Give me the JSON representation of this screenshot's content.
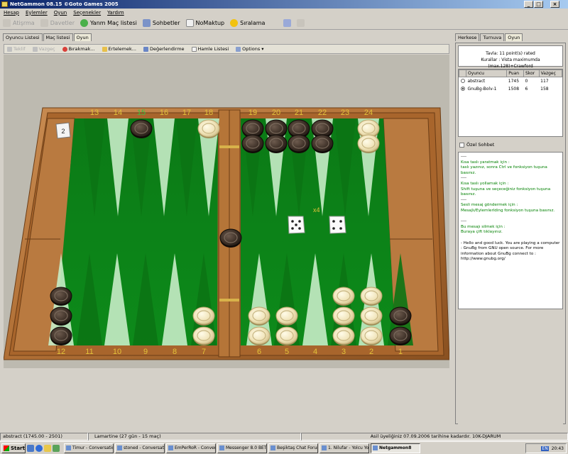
{
  "window": {
    "title": "NetGammon 08.15 ©Goto Games 2005",
    "controls": [
      "_",
      "□",
      "×"
    ]
  },
  "menu": [
    "Hesap",
    "Eylemler",
    "Oyun",
    "Seçenekler",
    "Yardım"
  ],
  "toolbar": {
    "items": [
      {
        "label": "Atişrma",
        "enabled": false,
        "icon": "play-icon"
      },
      {
        "label": "Davetler",
        "enabled": false,
        "icon": "invite-icon"
      },
      {
        "label": "Yanm Maç listesi",
        "enabled": true,
        "icon": "globe-icon"
      },
      {
        "label": "Sohbetler",
        "enabled": true,
        "icon": "chat-icon"
      },
      {
        "label": "NoMaktup",
        "enabled": true,
        "icon": "mail-icon"
      },
      {
        "label": "Sıralama",
        "enabled": true,
        "icon": "ranking-icon"
      }
    ]
  },
  "left_tabs": {
    "items": [
      "Oyuncu Listesi",
      "Maç listesi",
      "Oyun"
    ],
    "active": 2
  },
  "game_toolbar": {
    "items": [
      {
        "label": "Teklif",
        "enabled": false
      },
      {
        "label": "Vazgeç",
        "enabled": false
      },
      {
        "label": "Bırakmak...",
        "enabled": true
      },
      {
        "label": "Ertelemek...",
        "enabled": true
      },
      {
        "label": "Değerlendirme",
        "enabled": true
      },
      {
        "label": "Hamle Listesi",
        "enabled": true
      },
      {
        "label": "Options",
        "enabled": true
      }
    ]
  },
  "board": {
    "top_point_labels": [
      "13",
      "14",
      "15",
      "16",
      "17",
      "18",
      "19",
      "20",
      "21",
      "22",
      "23",
      "24"
    ],
    "bottom_point_labels": [
      "12",
      "11",
      "10",
      "9",
      "8",
      "7",
      "6",
      "5",
      "4",
      "3",
      "2",
      "1"
    ],
    "highlighted_point": "15",
    "cube_value": "2",
    "dice": [
      5,
      4
    ],
    "dice_multiplier": "x4",
    "checkers": {
      "point_15": {
        "color": "dark",
        "count": 1
      },
      "point_18": {
        "color": "light",
        "count": 1
      },
      "point_19": {
        "color": "dark",
        "count": 2
      },
      "point_20": {
        "color": "dark",
        "count": 2
      },
      "point_21": {
        "color": "dark",
        "count": 2
      },
      "point_22": {
        "color": "dark",
        "count": 2
      },
      "point_24": {
        "color": "light",
        "count": 2
      },
      "point_12": {
        "color": "dark",
        "count": 3
      },
      "point_7": {
        "color": "light",
        "count": 2
      },
      "point_6": {
        "color": "light",
        "count": 2
      },
      "point_5": {
        "color": "light",
        "count": 2
      },
      "point_3": {
        "color": "light",
        "count": 3
      },
      "point_2": {
        "color": "light",
        "count": 3
      },
      "point_1": {
        "color": "dark",
        "count": 2
      },
      "bar": {
        "color": "dark",
        "count": 1
      }
    }
  },
  "right_tabs": {
    "items": [
      "Herkese",
      "Turnuva",
      "Oyun"
    ],
    "active": 2
  },
  "match_info": {
    "line1": "Tavla: 11 point(s) rated",
    "line2": "Kurallar : Vista maximumda (max.128)+Crawford"
  },
  "players_table": {
    "headers": [
      "Oyuncu",
      "Puan",
      "Skor",
      "Vazgeç"
    ],
    "rows": [
      {
        "selected": false,
        "name": "abstract",
        "rating": "1745",
        "score": "0",
        "pip": "117"
      },
      {
        "selected": true,
        "name": "GnuBg-Bolv-1",
        "rating": "1508",
        "score": "6",
        "pip": "158"
      }
    ]
  },
  "private_chat_label": "Özel Sohbet",
  "chat": {
    "lines": [
      {
        "text": "----",
        "green": false
      },
      {
        "text": "Kısa taslı yaratmak için :",
        "green": true
      },
      {
        "text": "taslı yazınız, sonra Ctrl ve fonksiyon tuşuna basınız.",
        "green": true
      },
      {
        "text": "----",
        "green": false
      },
      {
        "text": "Kısa taslı yollamak için :",
        "green": true
      },
      {
        "text": "Shift tuşuna ve seçeceğiniz fonksiyon tuşuna basınız.",
        "green": true
      },
      {
        "text": "----",
        "green": false
      },
      {
        "text": "Sesli mesaj göndermek için :",
        "green": true
      },
      {
        "text": "Mesajlı/Eylemlerlding fonksiyon tuşuna basınız.",
        "green": true
      },
      {
        "text": "",
        "green": false
      },
      {
        "text": "----",
        "green": false
      },
      {
        "text": "Bu mesajı silmek için :",
        "green": true
      },
      {
        "text": "Buraya çift tıklayınız.",
        "green": true
      },
      {
        "text": "",
        "green": false
      },
      {
        "text": "- Hello and good luck. You are playing a computer : GnuBg from GNU open source. For more information about GnuBg connect to : http://www.gnubg.org/",
        "green": false
      }
    ]
  },
  "status_bar": {
    "left": "abstract (1745.00 - 2501)",
    "middle": "Lamartine (27 gün - 15 maç)",
    "right": "Asil üyeliğiniz 07.09.2006 tarihine kadardır. 10K-DJARUM"
  },
  "taskbar": {
    "start": "Start",
    "buttons": [
      {
        "label": "Timur - Conversation",
        "active": false
      },
      {
        "label": "stoned - Conversation",
        "active": false
      },
      {
        "label": "EmPerRoR - Conver...",
        "active": false
      },
      {
        "label": "Messenger 8.0 BETA",
        "active": false
      },
      {
        "label": "Beşiktaş Chat Forum",
        "active": false
      },
      {
        "label": "1. Nilufar - Yolcu Yol",
        "active": false
      },
      {
        "label": "Netgammon8",
        "active": true
      }
    ],
    "lang": "EN",
    "clock": "20:43"
  }
}
